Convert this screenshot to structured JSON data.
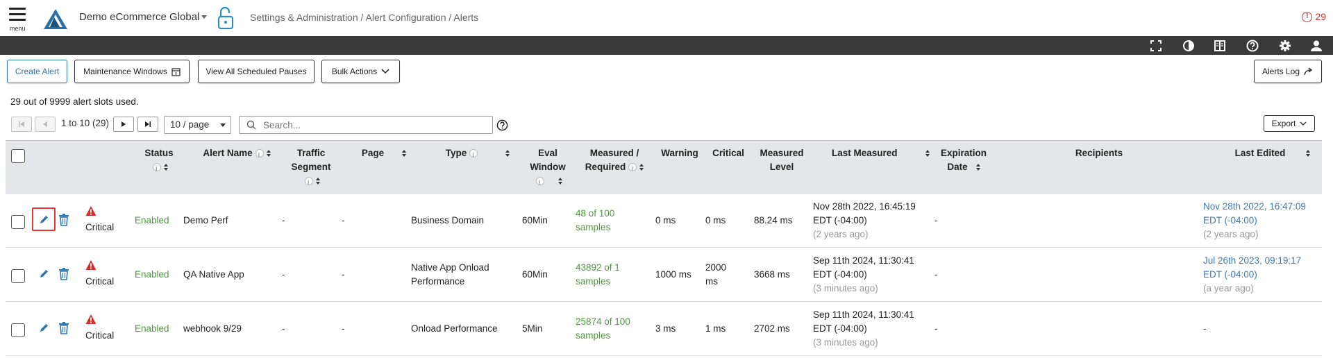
{
  "header": {
    "menu_label": "menu",
    "company": "Demo eCommerce Global",
    "breadcrumb": "Settings & Administration / Alert Configuration / Alerts",
    "alert_count": "29",
    "colors": {
      "accent": "#2a77b5",
      "critical": "#d32f2f",
      "enabled": "#4a9a3a",
      "toolbar": "#3a3a3a"
    }
  },
  "toolbar_icons": [
    "fullscreen-icon",
    "contrast-icon",
    "book-icon",
    "help-icon",
    "settings-icon",
    "user-icon"
  ],
  "actions": {
    "create_alert": "Create Alert",
    "maintenance_windows": "Maintenance Windows",
    "view_scheduled_pauses": "View All Scheduled Pauses",
    "bulk_actions": "Bulk Actions",
    "alerts_log": "Alerts Log"
  },
  "slots_text": "29 out of 9999 alert slots used.",
  "pagination": {
    "range": "1 to 10 (29)",
    "per_page": "10 / page",
    "search_placeholder": "Search...",
    "export": "Export"
  },
  "columns": {
    "status": "Status",
    "alert_name": "Alert Name",
    "traffic_segment_1": "Traffic",
    "traffic_segment_2": "Segment",
    "page": "Page",
    "type": "Type",
    "eval_window_1": "Eval",
    "eval_window_2": "Window",
    "measured_required_1": "Measured /",
    "measured_required_2": "Required",
    "warning": "Warning",
    "critical": "Critical",
    "measured_level_1": "Measured",
    "measured_level_2": "Level",
    "last_measured": "Last Measured",
    "expiration_1": "Expiration",
    "expiration_2": "Date",
    "recipients": "Recipients",
    "last_edited": "Last Edited"
  },
  "rows": [
    {
      "severity": "Critical",
      "status": "Enabled",
      "name": "Demo Perf",
      "traffic_segment": "-",
      "page": "-",
      "type_1": "Business Domain",
      "type_2": "",
      "eval_window": "60Min",
      "measured_1": "48 of 100",
      "measured_2": "samples",
      "warning_1": "0 ms",
      "warning_2": "",
      "critical_1": "0 ms",
      "critical_2": "",
      "measured_level": "88.24 ms",
      "last_measured_1": "Nov 28th 2022, 16:45:19",
      "last_measured_2": "EDT (-04:00)",
      "last_measured_ago": "(2 years ago)",
      "expiration": "-",
      "last_edited_1": "Nov 28th 2022, 16:47:09",
      "last_edited_2": "EDT (-04:00)",
      "last_edited_ago": "(2 years ago)"
    },
    {
      "severity": "Critical",
      "status": "Enabled",
      "name": "QA Native App",
      "traffic_segment": "-",
      "page": "-",
      "type_1": "Native App Onload",
      "type_2": "Performance",
      "eval_window": "60Min",
      "measured_1": "43892 of 1",
      "measured_2": "samples",
      "warning_1": "1000 ms",
      "warning_2": "",
      "critical_1": "2000",
      "critical_2": "ms",
      "measured_level": "3668 ms",
      "last_measured_1": "Sep 11th 2024, 11:30:41",
      "last_measured_2": "EDT (-04:00)",
      "last_measured_ago": "(3 minutes ago)",
      "expiration": "-",
      "last_edited_1": "Jul 26th 2023, 09:19:17",
      "last_edited_2": "EDT (-04:00)",
      "last_edited_ago": "(a year ago)"
    },
    {
      "severity": "Critical",
      "status": "Enabled",
      "name": "webhook 9/29",
      "traffic_segment": "-",
      "page": "-",
      "type_1": "Onload Performance",
      "type_2": "",
      "eval_window": "5Min",
      "measured_1": "25874 of 100",
      "measured_2": "samples",
      "warning_1": "3 ms",
      "warning_2": "",
      "critical_1": "1 ms",
      "critical_2": "",
      "measured_level": "2702 ms",
      "last_measured_1": "Sep 11th 2024, 11:30:41",
      "last_measured_2": "EDT (-04:00)",
      "last_measured_ago": "(3 minutes ago)",
      "expiration": "-",
      "last_edited_1": "-",
      "last_edited_2": "",
      "last_edited_ago": ""
    }
  ]
}
